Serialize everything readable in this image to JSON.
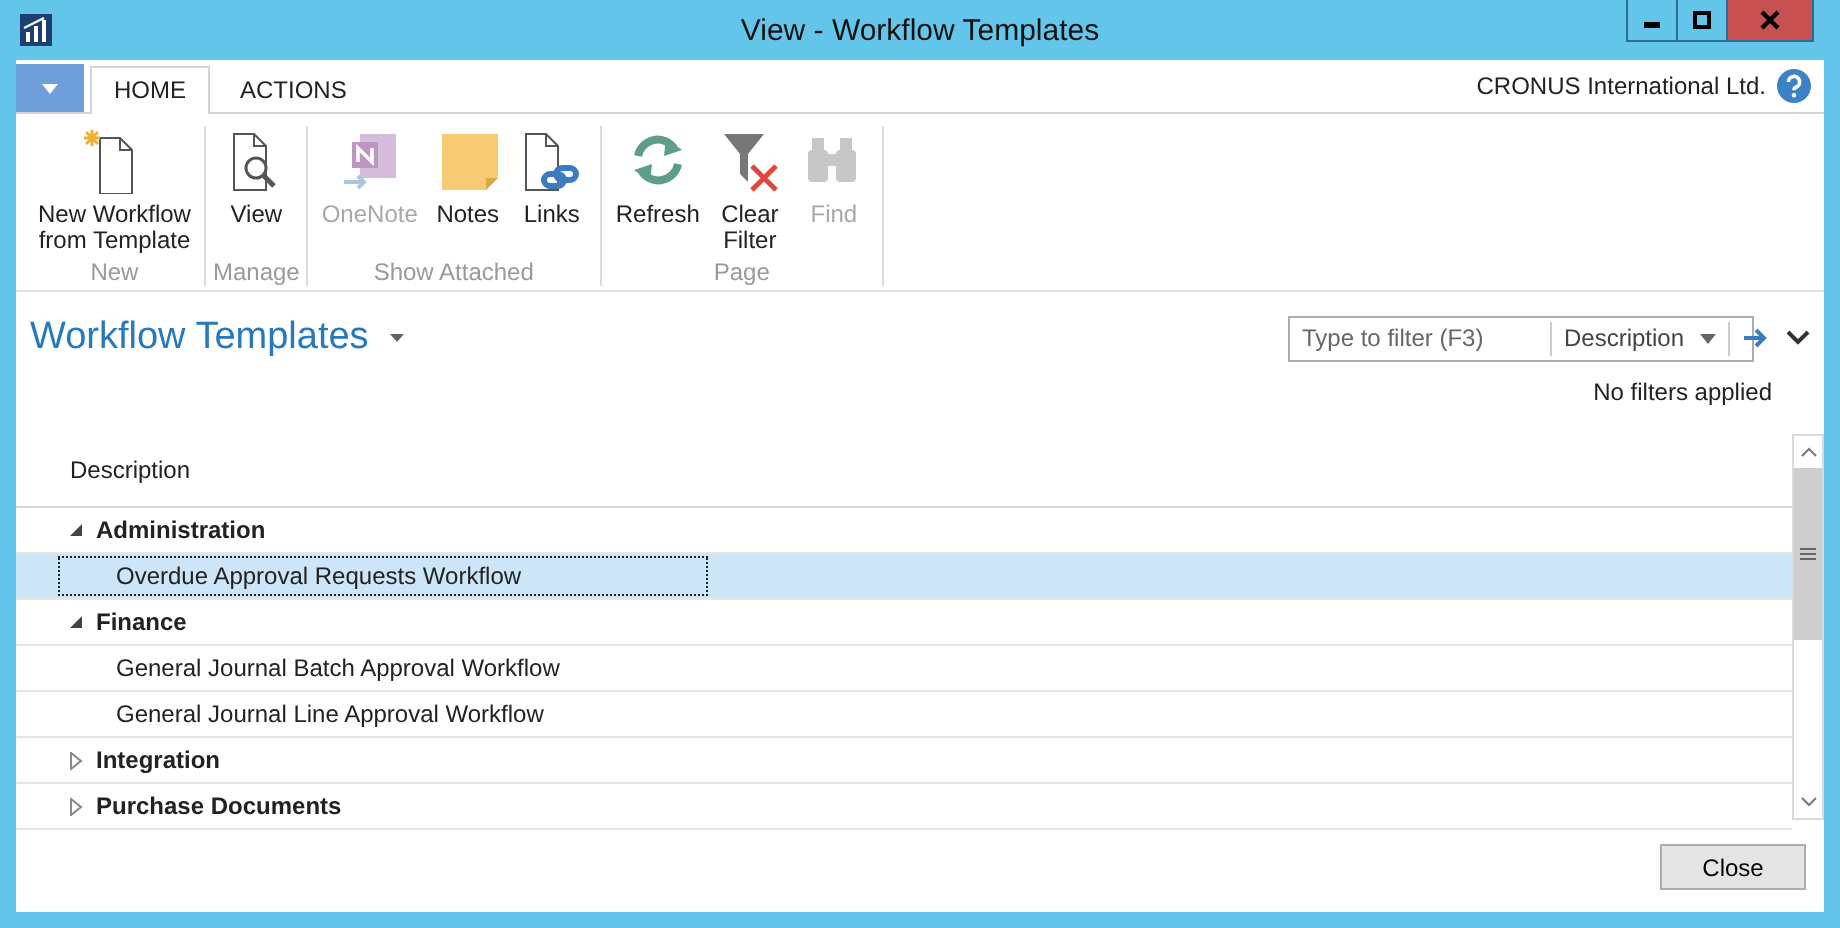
{
  "window": {
    "title": "View - Workflow Templates"
  },
  "ribbon": {
    "tabs": [
      {
        "label": "HOME",
        "selected": true
      },
      {
        "label": "ACTIONS",
        "selected": false
      }
    ],
    "company": "CRONUS International Ltd.",
    "groups": [
      {
        "label": "New",
        "buttons": [
          {
            "label": "New Workflow\nfrom Template",
            "disabled": false
          }
        ]
      },
      {
        "label": "Manage",
        "buttons": [
          {
            "label": "View",
            "disabled": false
          }
        ]
      },
      {
        "label": "Show Attached",
        "buttons": [
          {
            "label": "OneNote",
            "disabled": true
          },
          {
            "label": "Notes",
            "disabled": false
          },
          {
            "label": "Links",
            "disabled": false
          }
        ]
      },
      {
        "label": "Page",
        "buttons": [
          {
            "label": "Refresh",
            "disabled": false
          },
          {
            "label": "Clear\nFilter",
            "disabled": false
          },
          {
            "label": "Find",
            "disabled": true
          }
        ]
      }
    ]
  },
  "page": {
    "title": "Workflow Templates",
    "filter": {
      "placeholder": "Type to filter (F3)",
      "field": "Description"
    },
    "filter_status": "No filters applied"
  },
  "table": {
    "columns": [
      "Description"
    ],
    "rows": [
      {
        "label": "Administration",
        "expanded": true,
        "children": [
          {
            "label": "Overdue Approval Requests Workflow",
            "selected": true
          }
        ]
      },
      {
        "label": "Finance",
        "expanded": true,
        "children": [
          {
            "label": "General Journal Batch Approval Workflow",
            "selected": false
          },
          {
            "label": "General Journal Line Approval Workflow",
            "selected": false
          }
        ]
      },
      {
        "label": "Integration",
        "expanded": false
      },
      {
        "label": "Purchase Documents",
        "expanded": false
      }
    ]
  },
  "buttons": [
    "Close"
  ]
}
